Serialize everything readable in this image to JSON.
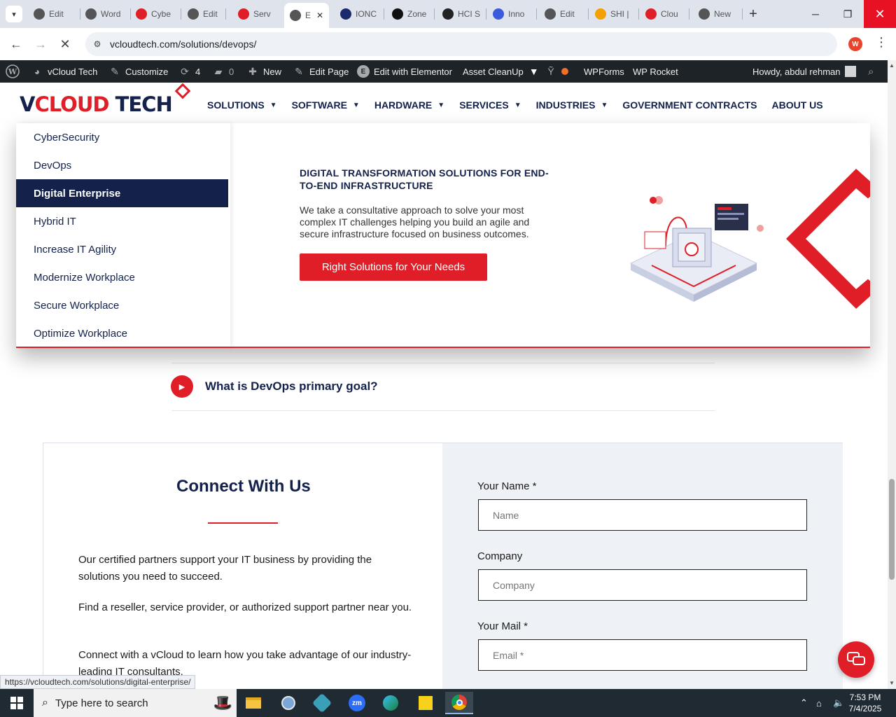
{
  "browser": {
    "tabs": [
      {
        "label": "Edit",
        "icon": "wordpress-icon",
        "color": "#555555"
      },
      {
        "label": "Word",
        "icon": "wordpress-icon",
        "color": "#555555"
      },
      {
        "label": "Cybe",
        "icon": "vcloud-icon",
        "color": "#e01e28"
      },
      {
        "label": "Edit",
        "icon": "wordpress-icon",
        "color": "#555555"
      },
      {
        "label": "Serv",
        "icon": "vcloud-icon",
        "color": "#e01e28"
      },
      {
        "label": "E",
        "icon": "loading-icon",
        "color": "#555555"
      },
      {
        "label": "IONC",
        "icon": "ionos-icon",
        "color": "#1b2a6b"
      },
      {
        "label": "Zone",
        "icon": "zones-icon",
        "color": "#111111"
      },
      {
        "label": "HCI S",
        "icon": "hci-icon",
        "color": "#222222"
      },
      {
        "label": "Inno",
        "icon": "innovate-icon",
        "color": "#3b5bdb"
      },
      {
        "label": "Edit",
        "icon": "wordpress-icon",
        "color": "#555555"
      },
      {
        "label": "SHI |",
        "icon": "shi-icon",
        "color": "#f2a100"
      },
      {
        "label": "Clou",
        "icon": "cloud-icon",
        "color": "#e01e28"
      },
      {
        "label": "New",
        "icon": "chrome-icon",
        "color": "#555555"
      }
    ],
    "url": "vcloudtech.com/solutions/devops/",
    "status_url": "https://vcloudtech.com/solutions/digital-enterprise/",
    "profile_initial": "W"
  },
  "adminbar": {
    "site": "vCloud Tech",
    "customize": "Customize",
    "updates": "4",
    "comments": "0",
    "new": "New",
    "edit_page": "Edit Page",
    "elementor": "Edit with Elementor",
    "asset_cleanup": "Asset CleanUp",
    "wpforms": "WPForms",
    "wprocket": "WP Rocket",
    "howdy": "Howdy, abdul rehman"
  },
  "logo": {
    "v": "V",
    "cloud": "CLOUD",
    "tech": " TECH"
  },
  "nav": [
    {
      "label": "SOLUTIONS",
      "caret": true
    },
    {
      "label": "SOFTWARE",
      "caret": true
    },
    {
      "label": "HARDWARE",
      "caret": true
    },
    {
      "label": "SERVICES",
      "caret": true
    },
    {
      "label": "INDUSTRIES",
      "caret": true
    },
    {
      "label": "GOVERNMENT CONTRACTS",
      "caret": false
    },
    {
      "label": "ABOUT US",
      "caret": false
    }
  ],
  "mega_menu": {
    "items": [
      "CyberSecurity",
      "DevOps",
      "Digital Enterprise",
      "Hybrid IT",
      "Increase IT Agility",
      "Modernize Workplace",
      "Secure Workplace",
      "Optimize Workplace"
    ],
    "active_index": 2,
    "title": "DIGITAL TRANSFORMATION SOLUTIONS FOR END-TO-END INFRASTRUCTURE",
    "description": "We take a consultative approach to solve your most complex IT challenges helping you build an agile and secure infrastructure focused on business outcomes.",
    "button": "Right Solutions for Your Needs"
  },
  "faq": {
    "question": "What is DevOps primary goal?"
  },
  "connect": {
    "title": "Connect With Us",
    "paragraphs": [
      "Our certified partners support your IT business by providing the solutions you need to succeed.",
      "Find a reseller, service provider, or authorized support partner near you.",
      "Connect with a vCloud to learn how you take advantage of our industry-leading IT consultants."
    ],
    "form": {
      "name_label": "Your Name *",
      "name_placeholder": "Name",
      "company_label": "Company",
      "company_placeholder": "Company",
      "mail_label": "Your Mail *",
      "mail_placeholder": "Email *"
    }
  },
  "colors": {
    "brand_red": "#e01e28",
    "brand_navy": "#13214b"
  },
  "taskbar": {
    "search_placeholder": "Type here to search",
    "time": "7:53 PM",
    "date": "7/4/2025"
  }
}
